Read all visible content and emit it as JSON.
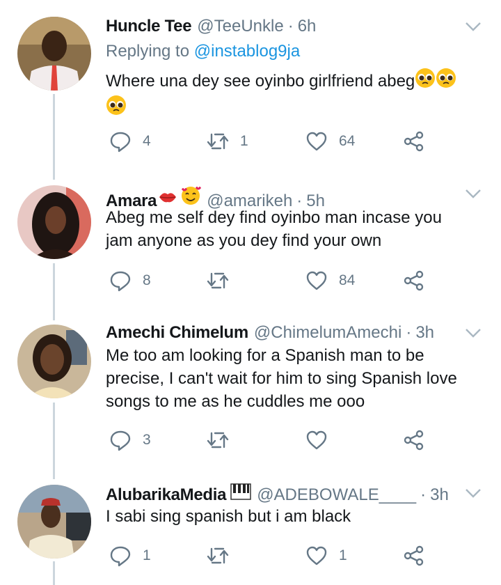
{
  "colors": {
    "text": "#14171a",
    "muted": "#657786",
    "link": "#1b95e0",
    "divider": "#e1e8ed",
    "thread": "#ccd6dd",
    "icon": "#657786"
  },
  "tweets": [
    {
      "name": "Huncle Tee",
      "handle": "@TeeUnkle",
      "dot": "·",
      "time": "6h",
      "reply_prefix": "Replying to",
      "reply_to": "@instablog9ja",
      "text": "Where una dey see oyinbo girlfriend abeg",
      "text_emojis": [
        "pleading-face",
        "pleading-face",
        "pleading-face"
      ],
      "reply_count": "4",
      "retweet_count": "1",
      "like_count": "64"
    },
    {
      "name": "Amara",
      "name_emojis": [
        "kiss-mark",
        "smiling-face-with-hearts"
      ],
      "handle": "@amarikeh",
      "dot": "·",
      "time": "5h",
      "text": "Abeg me self dey find oyinbo man incase you jam anyone as you dey find your own",
      "reply_count": "8",
      "retweet_count": "",
      "like_count": "84"
    },
    {
      "name": "Amechi Chimelum",
      "handle": "@ChimelumAmechi",
      "dot": "·",
      "time": "3h",
      "text": "Me too am looking for a Spanish man to be precise, I can't wait for him to sing Spanish love songs to me as he cuddles me ooo",
      "reply_count": "3",
      "retweet_count": "",
      "like_count": ""
    },
    {
      "name": "AlubarikaMedia",
      "name_emojis": [
        "musical-keyboard"
      ],
      "handle": "@ADEBOWALE____",
      "dot": "·",
      "time": "3h",
      "text": "I sabi sing spanish but i am black",
      "reply_count": "1",
      "retweet_count": "",
      "like_count": "1"
    }
  ]
}
